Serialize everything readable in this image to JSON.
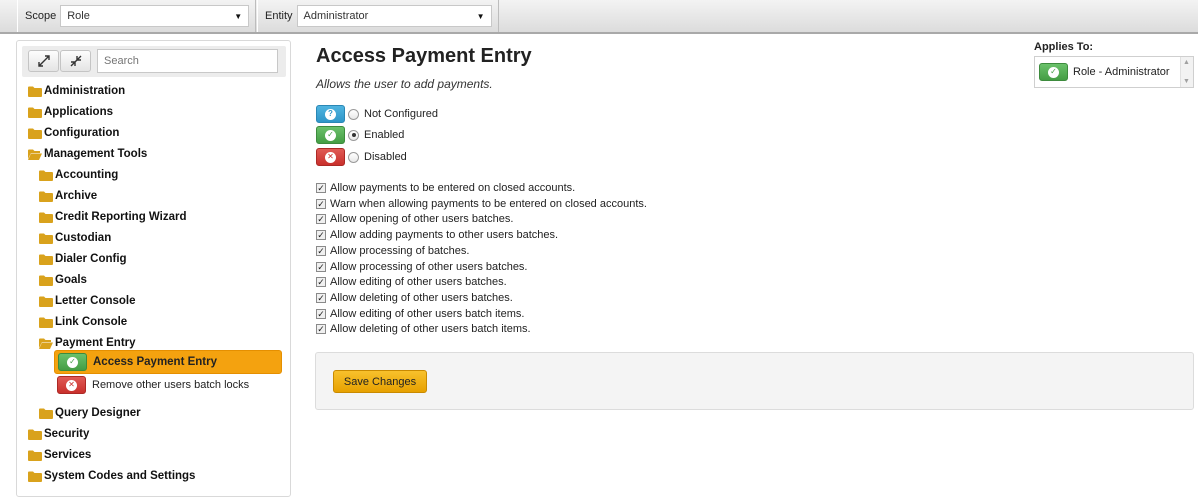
{
  "topbar": {
    "scope_label": "Scope",
    "scope_value": "Role",
    "entity_label": "Entity",
    "entity_value": "Administrator"
  },
  "tree": {
    "search_placeholder": "Search",
    "nodes": {
      "administration": "Administration",
      "applications": "Applications",
      "configuration": "Configuration",
      "management_tools": "Management Tools",
      "accounting": "Accounting",
      "archive": "Archive",
      "credit_reporting_wizard": "Credit Reporting Wizard",
      "custodian": "Custodian",
      "dialer_config": "Dialer Config",
      "goals": "Goals",
      "letter_console": "Letter Console",
      "link_console": "Link Console",
      "payment_entry": "Payment Entry",
      "access_payment_entry": "Access Payment Entry",
      "remove_batch_locks": "Remove other users batch locks",
      "query_designer": "Query Designer",
      "security": "Security",
      "services": "Services",
      "system_codes": "System Codes and Settings"
    },
    "icons": {
      "expand": "expand-all-icon",
      "collapse": "collapse-all-icon",
      "folder": "folder-icon",
      "folder_open": "folder-open-icon"
    }
  },
  "main": {
    "title": "Access Payment Entry",
    "description": "Allows the user to add payments.",
    "options": {
      "not_configured": "Not Configured",
      "enabled": "Enabled",
      "disabled": "Disabled",
      "selected": "enabled"
    },
    "permissions": [
      "Allow payments to be entered on closed accounts.",
      "Warn when allowing payments to be entered on closed accounts.",
      "Allow opening of other users batches.",
      "Allow adding payments to other users batches.",
      "Allow processing of batches.",
      "Allow processing of other users batches.",
      "Allow editing of other users batches.",
      "Allow deleting of other users batches.",
      "Allow editing of other users batch items.",
      "Allow deleting of other users batch items."
    ],
    "save_label": "Save Changes"
  },
  "applies_to": {
    "label": "Applies To:",
    "item": "Role - Administrator"
  },
  "colors": {
    "accent": "#f4a20f",
    "enabled": "#449d44",
    "disabled": "#c9302c",
    "not_configured": "#2f96c8"
  }
}
